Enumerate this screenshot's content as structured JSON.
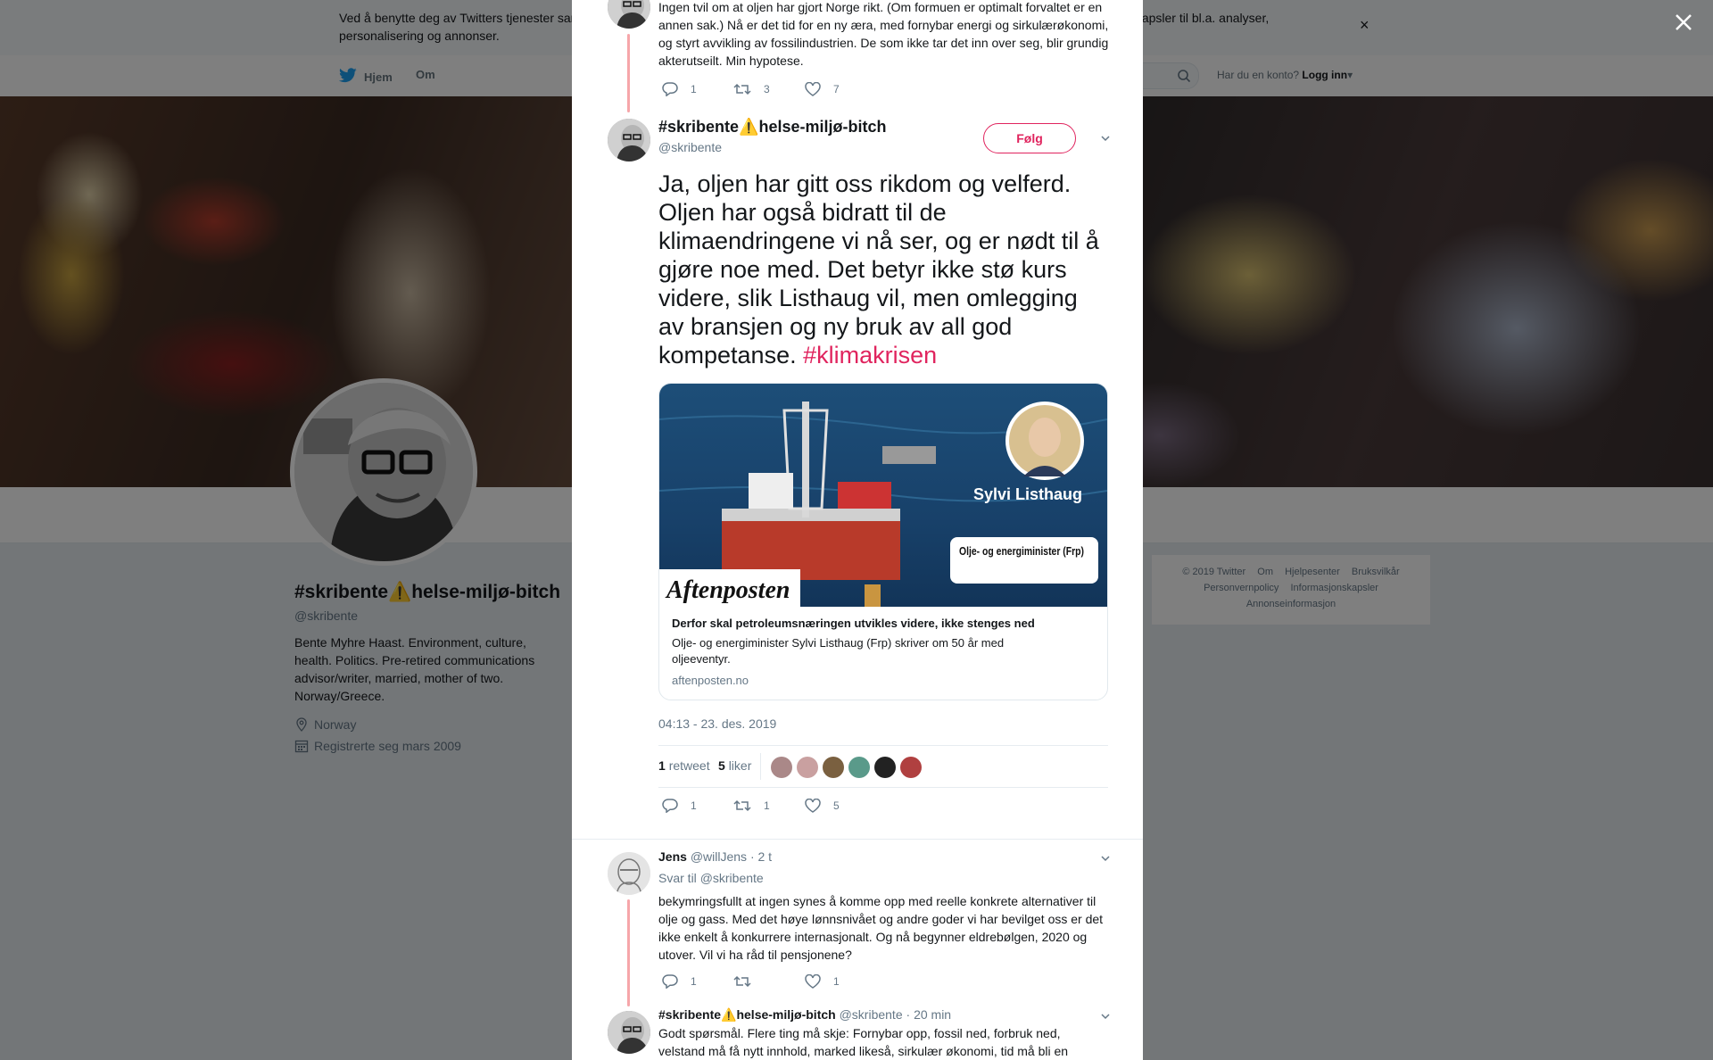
{
  "cookie_banner": {
    "text": "Ved å benytte deg av Twitters tjenester samtykker du i vår bruk av informasjonskapsler. Vi og våre partnere driver globalt og bruker informasjonskapsler til bl.a. analyser, personalisering og annonser.",
    "close_label": "×"
  },
  "topnav": {
    "home_label": "Hjem",
    "about_label": "Om",
    "account_prompt": "Har du en konto?",
    "login_label": "Logg inn"
  },
  "profile": {
    "name": "#skribente⚠️helse-miljø-bitch",
    "handle": "@skribente",
    "bio": "Bente Myhre Haast. Environment, culture, health. Politics. Pre-retired communications advisor/writer, married, mother of two. Norway/Greece.",
    "location": "Norway",
    "joined": "Registrerte seg mars 2009"
  },
  "footer": {
    "links_row1": [
      "© 2019 Twitter",
      "Om",
      "Hjelpesenter",
      "Bruksvilkår"
    ],
    "links_row2": [
      "Personvernpolicy",
      "Informasjonskapsler"
    ],
    "links_row3": [
      "Annonseinformasjon"
    ]
  },
  "modal": {
    "prev_tweet": {
      "text": "Ingen tvil om at oljen har gjort Norge rikt. (Om formuen er optimalt forvaltet er en annen sak.) Nå er det tid for en ny æra, med fornybar energi og sirkulærøkonomi, og styrt avvikling av fossilindustrien. De som ikke tar det inn over seg, blir grundig akterutseilt. Min hypotese.",
      "replies": "1",
      "retweets": "3",
      "likes": "7"
    },
    "main_tweet": {
      "name": "#skribente⚠️helse-miljø-bitch",
      "handle": "@skribente",
      "follow_label": "Følg",
      "text": "Ja, oljen har gitt oss rikdom og velferd. Oljen har også bidratt til de klimaendringene vi nå ser, og er nødt til å gjøre noe med. Det betyr ikke stø kurs videre, slik Listhaug vil, men omlegging av bransjen og ny bruk av all god kompetanse.",
      "hashtag": "#klimakrisen",
      "card": {
        "image_name": "Sylvi Listhaug",
        "image_role": "Olje- og energiminister (Frp)",
        "logo": "Aftenposten",
        "title": "Derfor skal petroleumsnæringen utvikles videre, ikke stenges ned",
        "description": "Olje- og energiminister Sylvi Listhaug (Frp) skriver om 50 år med oljeeventyr.",
        "domain": "aftenposten.no"
      },
      "timestamp": "04:13 - 23. des. 2019",
      "retweet_count": "1",
      "retweet_label": "retweet",
      "like_count": "5",
      "like_label": "liker",
      "replies": "1",
      "retweets": "1",
      "likes": "5"
    },
    "reply1": {
      "name": "Jens",
      "handle": "@willJens",
      "time": "· 2 t",
      "reply_to_label": "Svar til",
      "reply_to_handle": "@skribente",
      "text": "bekymringsfullt at ingen synes å komme opp med reelle konkrete alternativer til olje og gass. Med det høye lønnsnivået og andre goder vi har bevilget oss er det ikke enkelt å konkurrere internasjonalt.  Og nå begynner eldrebølgen, 2020 og utover. Vil vi ha råd til pensjonene?",
      "replies": "1",
      "retweets": "",
      "likes": "1"
    },
    "reply2": {
      "name": "#skribente⚠️helse-miljø-bitch",
      "handle": "@skribente",
      "time": "· 20 min",
      "text": "Godt spørsmål. Flere ting må skje: Fornybar opp, fossil ned, forbruk ned, velstand må få nytt innhold, marked likeså, sirkulær økonomi, tid må bli en"
    }
  },
  "colors": {
    "accent": "#e0245e",
    "thread_line": "#f6a6aa",
    "twitter_blue": "#1da1f2"
  }
}
